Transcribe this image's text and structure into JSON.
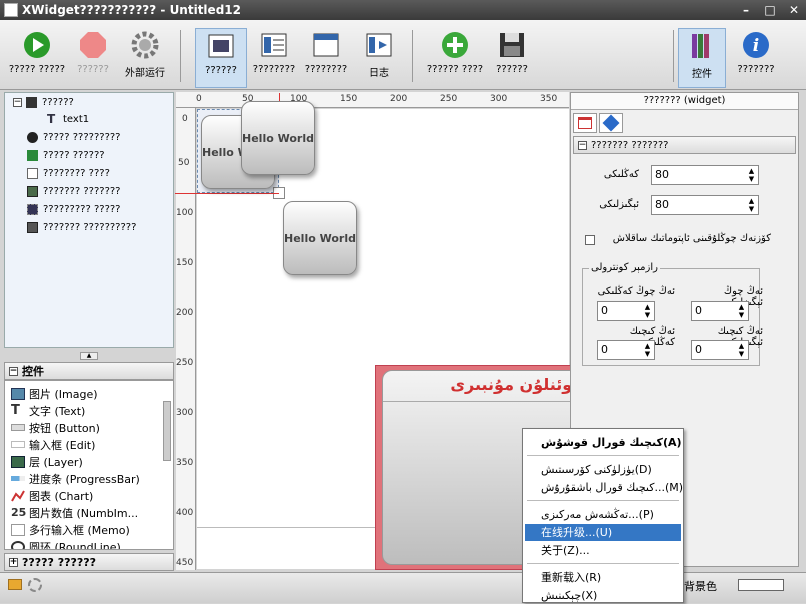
{
  "window": {
    "title": "XWidget??????????? - Untitled12",
    "minimize": "–",
    "maximize": "□",
    "close": "✕"
  },
  "toolbar": {
    "items": [
      {
        "label": "????? ?????",
        "icon": "play-icon"
      },
      {
        "label": "??????",
        "icon": "stop-icon"
      },
      {
        "label": "外部运行",
        "icon": "gear-icon"
      },
      {
        "label": "??????",
        "icon": "widget-view-icon"
      },
      {
        "label": "????????",
        "icon": "list-view-icon"
      },
      {
        "label": "????????",
        "icon": "window-view-icon"
      },
      {
        "label": "日志",
        "icon": "log-icon"
      },
      {
        "label": "?????? ????",
        "icon": "add-icon"
      },
      {
        "label": "??????",
        "icon": "save-icon"
      },
      {
        "label": "控件",
        "icon": "books-icon"
      },
      {
        "label": "???????",
        "icon": "info-icon"
      }
    ]
  },
  "tree": {
    "items": [
      {
        "label": "??????",
        "icon": "widget-node-icon"
      },
      {
        "label": "text1",
        "icon": "text-node-icon"
      },
      {
        "label": "????? ?????????",
        "icon": "close-node-icon"
      },
      {
        "label": "????? ??????",
        "icon": "search-node-icon"
      },
      {
        "label": "???????? ????",
        "icon": "doc-node-icon"
      },
      {
        "label": "??????? ???????",
        "icon": "frame-node-icon"
      },
      {
        "label": "????????? ?????",
        "icon": "fit-node-icon"
      },
      {
        "label": "??????? ??????????",
        "icon": "box-node-icon"
      }
    ]
  },
  "widgets_panel": {
    "title": "控件",
    "items": [
      {
        "label": "图片 (Image)",
        "icon": "image-icon"
      },
      {
        "label": "文字 (Text)",
        "icon": "text-icon"
      },
      {
        "label": "按钮 (Button)",
        "icon": "button-icon"
      },
      {
        "label": "输入框 (Edit)",
        "icon": "edit-icon"
      },
      {
        "label": "层 (Layer)",
        "icon": "layer-icon"
      },
      {
        "label": "进度条 (ProgressBar)",
        "icon": "progress-icon"
      },
      {
        "label": "图表 (Chart)",
        "icon": "chart-icon"
      },
      {
        "label": "图片数值 (NumbIm...",
        "icon": "number-image-icon"
      },
      {
        "label": "多行输入框 (Memo)",
        "icon": "memo-icon"
      },
      {
        "label": "圆环 (RoundLine)",
        "icon": "round-icon"
      }
    ],
    "footer": "????? ??????"
  },
  "ruler": {
    "top": [
      "0",
      "50",
      "100",
      "150",
      "200",
      "250",
      "300",
      "350"
    ],
    "left": [
      "0",
      "50",
      "100",
      "150",
      "200",
      "250",
      "300",
      "350",
      "400",
      "450"
    ]
  },
  "canvas": {
    "widget_text": "Hello World",
    "big_title": "كوئنلۇن مۇنبىرى"
  },
  "props": {
    "title": "??????? (widget)",
    "section": "??????? ???????",
    "width_label": "كەڭلىكى",
    "width_value": "80",
    "height_label": "ئېگىزلىكى",
    "height_value": "80",
    "checkbox_label": "كۆزنەك چوڭلۇقىنى ئاپتوماتىك ساقلاش",
    "group_title": "رازمېر كونترولى",
    "min_width_label": "ئەڭ چوڭ كەڭلىكى",
    "min_width_value": "0",
    "min_height_label": "ئەڭ چوڭ ئېگىزلىكى",
    "min_height_value": "0",
    "max_width_label": "ئەڭ كىچىك كەڭلىكى",
    "max_width_value": "0",
    "max_height_label": "ئەڭ كىچىك ئېگىزلىكى",
    "max_height_value": "0"
  },
  "context_menu": {
    "items": [
      {
        "label": "كىچىك قورال قوشۇش(A)",
        "highlighted": false
      },
      {
        "label": "يۈزلۈكنى كۆرسىتىش(D)",
        "highlighted": false
      },
      {
        "label": "كىچىك قورال باشقۇرۇش...(M)",
        "highlighted": false
      },
      {
        "label": "تەڭشەش مەركىزى...(P)",
        "highlighted": false
      },
      {
        "label": "在线升级...(U)",
        "highlighted": true
      },
      {
        "label": "关于(Z)...",
        "highlighted": false
      },
      {
        "label": "重新载入(R)",
        "highlighted": false
      },
      {
        "label": "چېكىنىش(X)",
        "highlighted": false
      }
    ]
  },
  "statusbar": {
    "bg_color_label": "背景色"
  },
  "colors": {
    "highlight": "#3477c5",
    "accent_red": "#d03030",
    "widget_border": "#e0727a"
  }
}
